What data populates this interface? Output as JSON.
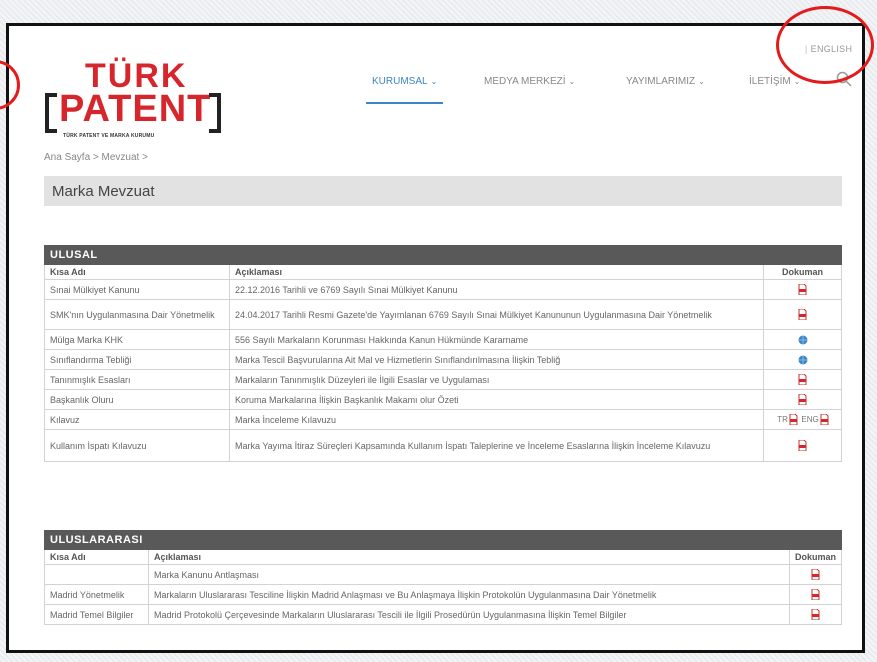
{
  "header": {
    "language_link": "ENGLISH",
    "logo": {
      "line1": "TÜRK",
      "line2": "PATENT",
      "subtitle": "TÜRK PATENT VE MARKA KURUMU"
    },
    "nav": [
      {
        "label": "KURUMSAL"
      },
      {
        "label": "MEDYA MERKEZİ"
      },
      {
        "label": "YAYIMLARIMIZ"
      },
      {
        "label": "İLETİŞİM"
      }
    ]
  },
  "breadcrumb": "Ana Sayfa > Mevzuat >",
  "page_title": "Marka Mevzuat",
  "ulusal": {
    "section_title": "ULUSAL",
    "columns": [
      "Kısa Adı",
      "Açıklaması",
      "Dokuman"
    ],
    "rows": [
      {
        "name": "Sınai Mülkiyet Kanunu",
        "desc": "22.12.2016 Tarihli ve 6769 Sayılı Sınai Mülkiyet Kanunu",
        "doc": "pdf"
      },
      {
        "name": "SMK'nın Uygulanmasına Dair Yönetmelik",
        "desc": "24.04.2017 Tarihli Resmi Gazete'de Yayımlanan 6769 Sayılı Sınai Mülkiyet Kanununun Uygulanmasına Dair Yönetmelik",
        "doc": "pdf"
      },
      {
        "name": "Mülga Marka KHK",
        "desc": "556 Sayılı Markaların Korunması Hakkında Kanun Hükmünde Kararname",
        "doc": "link"
      },
      {
        "name": "Sınıflandırma Tebliği",
        "desc": "Marka Tescil Başvurularına Ait Mal ve Hizmetlerin Sınıflandırılmasına İlişkin Tebliğ",
        "doc": "link"
      },
      {
        "name": "Tanınmışlık Esasları",
        "desc": "Markaların Tanınmışlık Düzeyleri ile İlgili Esaslar ve Uygulaması",
        "doc": "pdf"
      },
      {
        "name": "Başkanlık Oluru",
        "desc": "Koruma Markalarına İlişkin Başkanlık Makamı olur Özeti",
        "doc": "pdf"
      },
      {
        "name": "Kılavuz",
        "desc": "Marka İnceleme Kılavuzu",
        "doc": "tr-eng",
        "doc_tr": "TR",
        "doc_eng": "ENG"
      },
      {
        "name": "Kullanım İspatı Kılavuzu",
        "desc": "Marka Yayıma İtiraz Süreçleri Kapsamında Kullanım İspatı Taleplerine ve İnceleme Esaslarına İlişkin İnceleme Kılavuzu",
        "doc": "pdf"
      }
    ]
  },
  "uluslararasi": {
    "section_title": "ULUSLARARASI",
    "columns": [
      "Kısa Adı",
      "Açıklaması",
      "Dokuman"
    ],
    "rows": [
      {
        "name": "",
        "desc": "Marka Kanunu Antlaşması",
        "doc": "pdf"
      },
      {
        "name": "Madrid Yönetmelik",
        "desc": "Markaların Uluslararası Tesciline İlişkin Madrid Anlaşması ve Bu Anlaşmaya İlişkin Protokolün Uygulanmasına Dair Yönetmelik",
        "doc": "pdf"
      },
      {
        "name": "Madrid Temel Bilgiler",
        "desc": "Madrid Protokolü Çerçevesinde Markaların Uluslararası Tescili ile İlgili Prosedürün Uygulanmasına İlişkin Temel Bilgiler",
        "doc": "pdf"
      }
    ]
  },
  "colors": {
    "brand_red": "#d7262b",
    "nav_active": "#3a86c8",
    "section_header": "#595959",
    "annotation": "#e31b1b"
  }
}
